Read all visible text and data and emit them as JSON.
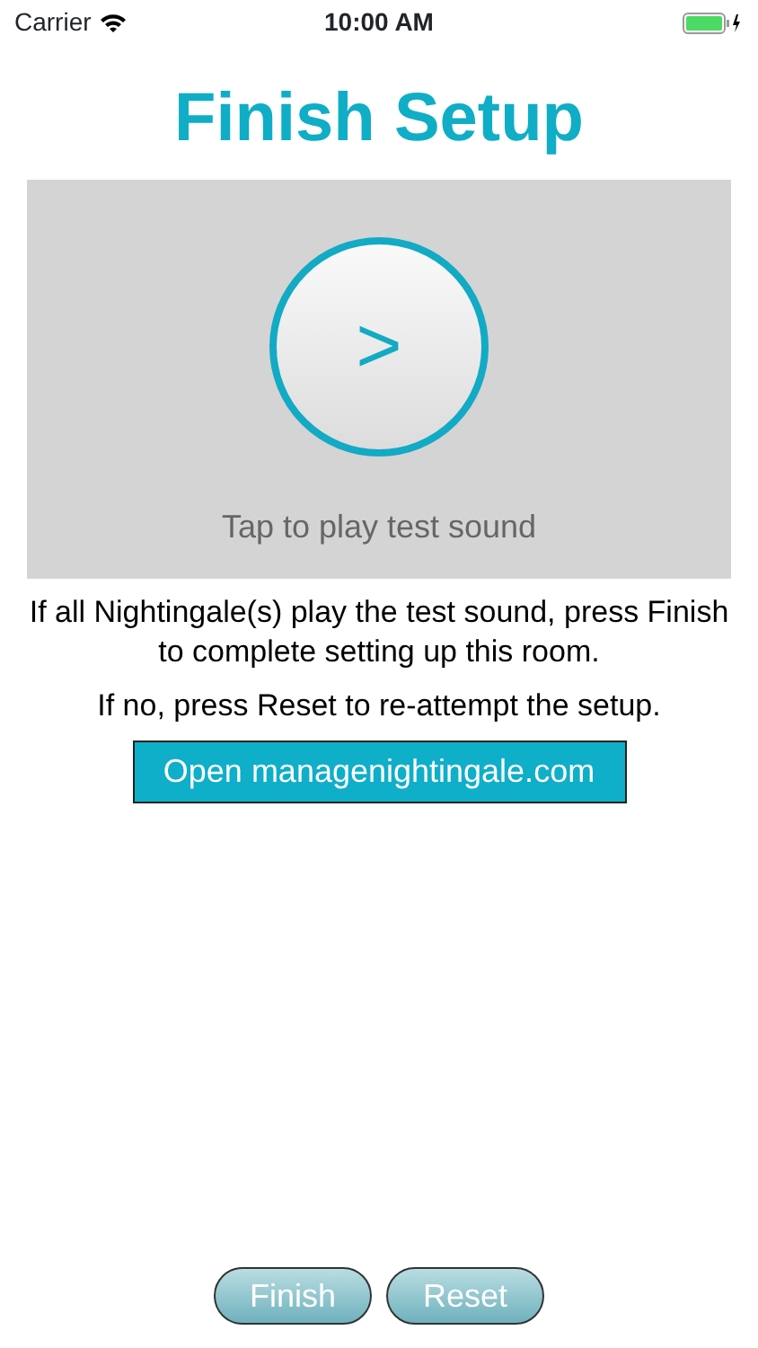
{
  "status_bar": {
    "carrier": "Carrier",
    "time": "10:00 AM"
  },
  "title": "Finish Setup",
  "player": {
    "symbol": ">",
    "caption": "Tap to play test sound"
  },
  "instructions": [
    "If all Nightingale(s) play the test sound, press Finish to complete setting up this room.",
    "If no, press Reset to re-attempt the setup."
  ],
  "link_button": "Open managenightingale.com",
  "buttons": [
    "Finish",
    "Reset"
  ]
}
